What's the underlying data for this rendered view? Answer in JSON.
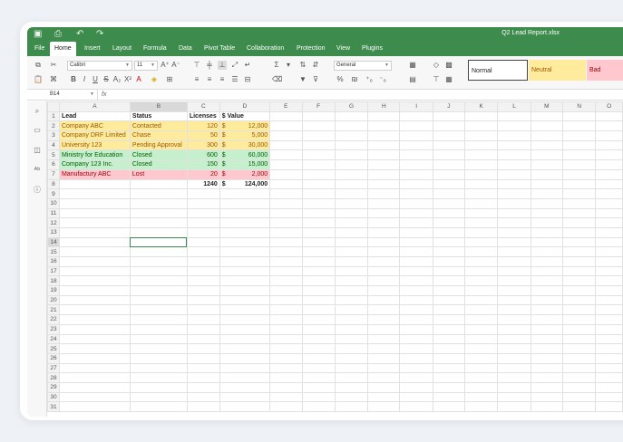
{
  "app": {
    "doc_title": "Q2 Lead Report.xlsx"
  },
  "menu": [
    "File",
    "Home",
    "Insert",
    "Layout",
    "Formula",
    "Data",
    "Pivot Table",
    "Collaboration",
    "Protection",
    "View",
    "Plugins"
  ],
  "active_menu": "Home",
  "toolbar": {
    "font_name": "Calibri",
    "font_size": "11",
    "number_format": "General",
    "styles": {
      "normal": "Normal",
      "neutral": "Neutral",
      "bad": "Bad"
    }
  },
  "formula_bar": {
    "cell_ref": "B14",
    "fx": "fx",
    "value": ""
  },
  "sheet": {
    "columns": [
      "A",
      "B",
      "C",
      "D",
      "E",
      "F",
      "G",
      "H",
      "I",
      "J",
      "K",
      "L",
      "M",
      "N",
      "O"
    ],
    "row_count": 31,
    "selected_cell": "B14",
    "header": {
      "lead": "Lead",
      "status": "Status",
      "licenses": "Licenses",
      "value": "$ Value"
    },
    "rows": [
      {
        "lead": "Company ABC",
        "status": "Contacted",
        "licenses": "120",
        "cur": "$",
        "value": "12,000",
        "style": "neutral"
      },
      {
        "lead": "Company DRF Limited",
        "status": "Chase",
        "licenses": "50",
        "cur": "$",
        "value": "5,000",
        "style": "neutral"
      },
      {
        "lead": "University 123",
        "status": "Pending Approval",
        "licenses": "300",
        "cur": "$",
        "value": "30,000",
        "style": "neutral"
      },
      {
        "lead": "Ministry for Education",
        "status": "Closed",
        "licenses": "600",
        "cur": "$",
        "value": "60,000",
        "style": "good"
      },
      {
        "lead": "Company 123 Inc.",
        "status": "Closed",
        "licenses": "150",
        "cur": "$",
        "value": "15,000",
        "style": "good"
      },
      {
        "lead": "Manufactury ABC",
        "status": "Lost",
        "licenses": "20",
        "cur": "$",
        "value": "2,000",
        "style": "bad"
      }
    ],
    "totals": {
      "licenses": "1240",
      "cur": "$",
      "value": "124,000"
    }
  },
  "colors": {
    "brand": "#3e8b4e",
    "neutral_bg": "#ffeb9c",
    "neutral_fg": "#9c5700",
    "good_bg": "#c6efce",
    "good_fg": "#006100",
    "bad_bg": "#ffc7ce",
    "bad_fg": "#9c0006"
  }
}
